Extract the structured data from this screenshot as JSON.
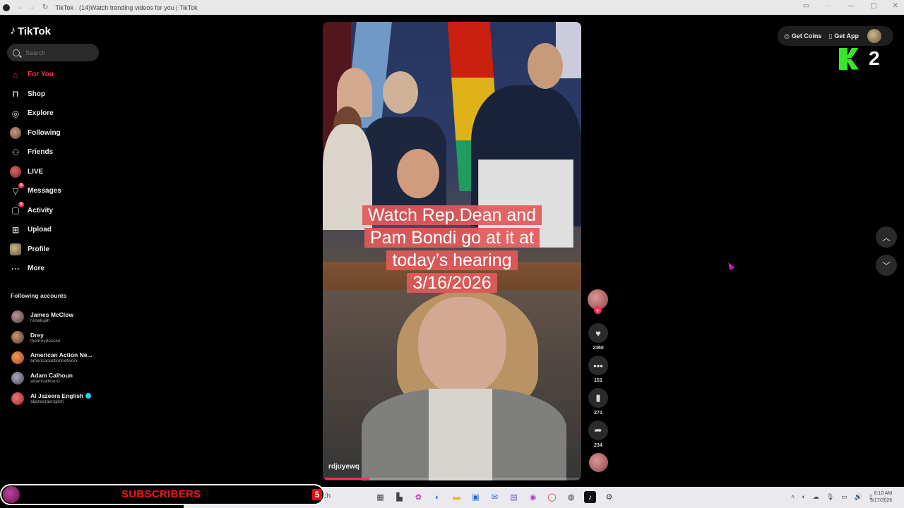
{
  "browser": {
    "tab_title": "TikTok · (14)Watch trending videos for you | TikTok",
    "nav_back": "←",
    "nav_forward": "→",
    "reload": "↻"
  },
  "sidebar": {
    "logo_text": "TikTok",
    "search_placeholder": "Search",
    "nav_items": [
      {
        "label": "For You",
        "icon": "home-icon",
        "active": true
      },
      {
        "label": "Shop",
        "icon": "shop-bag-icon"
      },
      {
        "label": "Explore",
        "icon": "compass-icon"
      },
      {
        "label": "Following",
        "icon": "following-avatar-icon"
      },
      {
        "label": "Friends",
        "icon": "friends-icon"
      },
      {
        "label": "LIVE",
        "icon": "live-avatar-icon"
      },
      {
        "label": "Messages",
        "icon": "messages-icon",
        "badge": "9"
      },
      {
        "label": "Activity",
        "icon": "activity-icon",
        "badge": "9"
      },
      {
        "label": "Upload",
        "icon": "upload-icon"
      },
      {
        "label": "Profile",
        "icon": "profile-avatar-icon"
      },
      {
        "label": "More",
        "icon": "more-dots-icon"
      }
    ],
    "following_title": "Following accounts",
    "accounts": [
      {
        "name": "James McClow",
        "handle": "hullalujah"
      },
      {
        "name": "Drey",
        "handle": "thedreydossier"
      },
      {
        "name": "American Action Ne...",
        "handle": "americanactionnetwork"
      },
      {
        "name": "Adam Calhoun",
        "handle": "adamcalhoun1"
      },
      {
        "name": "Al Jazeera English",
        "handle": "aljazeeraenglish",
        "verified": true
      }
    ]
  },
  "video": {
    "caption": "Watch Rep.Dean and Pam Bondi go at it at today’s hearing 3/16/2026",
    "uploader": "rdjuyewq",
    "progress": 0.18
  },
  "actions": {
    "likes": "2360",
    "comments": "151",
    "saves": "271",
    "shares": "234",
    "follow_plus": "+"
  },
  "topbar": {
    "get_coins": "Get Coins",
    "get_app": "Get App"
  },
  "overlay": {
    "k_number": "2",
    "subscribers_label": "SUBSCRIBERS",
    "subscribers_count": "5"
  },
  "taskbar": {
    "search_text": "Search",
    "clock_time": "6:10 AM",
    "clock_date": "3/17/2026"
  },
  "colors": {
    "accent": "#fe2c55",
    "caption_bg": "#e15a5a",
    "k_green": "#3ae62c",
    "subscribers_red": "#f01818"
  }
}
